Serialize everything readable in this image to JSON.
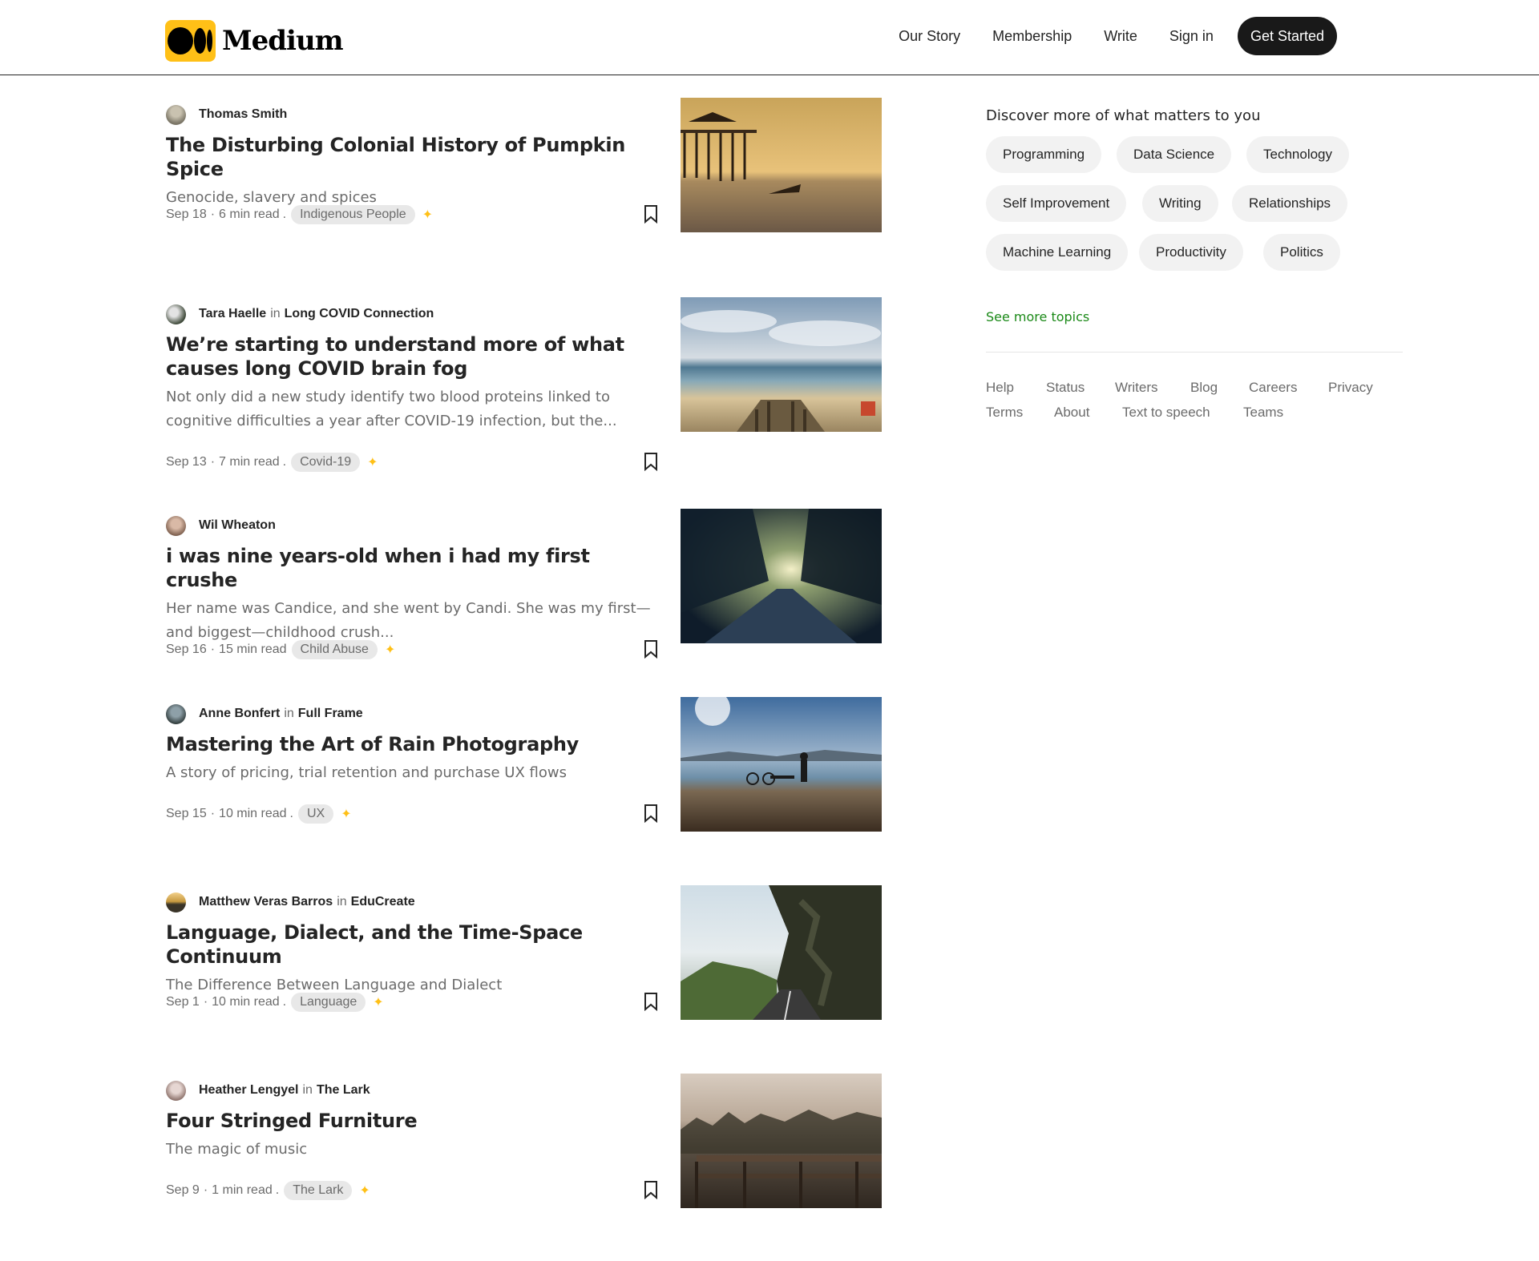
{
  "header": {
    "logo_text": "Medium",
    "nav": {
      "our_story": "Our Story",
      "membership": "Membership",
      "write": "Write",
      "sign_in": "Sign in",
      "get_started": "Get Started"
    }
  },
  "feed": {
    "articles": [
      {
        "author": "Thomas Smith",
        "in": "",
        "publication": "",
        "title": "The Disturbing Colonial History of Pumpkin Spice",
        "subtitle": "Genocide, slavery and spices",
        "date": "Sep 18",
        "read_time": "6 min read",
        "tag": "Indigenous People",
        "image": "pier-at-sunset"
      },
      {
        "author": "Tara Haelle",
        "in": "in",
        "publication": "Long COVID Connection",
        "title": "We’re starting to understand more of what causes long COVID brain fog",
        "subtitle": "Not only did a new study identify two blood proteins linked to cognitive difficulties a year after COVID-19 infection, but the...",
        "date": "Sep 13",
        "read_time": "7 min read",
        "tag": "Covid-19",
        "image": "beach-boardwalk"
      },
      {
        "author": "Wil Wheaton",
        "in": "",
        "publication": "",
        "title": "i was nine years-old when i had my first crushe",
        "subtitle": "Her name was Candice, and she went by Candi. She was my first—and biggest—childhood crush...",
        "date": "Sep 16",
        "read_time": "15 min read",
        "tag": "Child Abuse",
        "image": "forest-road"
      },
      {
        "author": "Anne Bonfert",
        "in": "in",
        "publication": "Full Frame",
        "title": "Mastering the Art of Rain Photography",
        "subtitle": "A story of pricing, trial retention and purchase UX flows",
        "date": "Sep 15",
        "read_time": "10 min read",
        "tag": "UX",
        "image": "person-by-lake"
      },
      {
        "author": "Matthew Veras Barros",
        "in": "in",
        "publication": "EduCreate",
        "title": "Language, Dialect, and the Time-Space Continuum",
        "subtitle": "The Difference Between Language and Dialect",
        "date": "Sep 1",
        "read_time": "10 min read",
        "tag": "Language",
        "image": "mountain-road-tunnel"
      },
      {
        "author": "Heather Lengyel",
        "in": "in",
        "publication": "The Lark",
        "title": "Four Stringed Furniture",
        "subtitle": "The magic of music",
        "date": "Sep 9",
        "read_time": "1 min read",
        "tag": "The Lark",
        "image": "misty-forest-bridge"
      }
    ],
    "meta_separator": "·",
    "tag_separator": ".",
    "sparkle_icon": "✦"
  },
  "sidebar": {
    "heading": "Discover more of what matters to you",
    "topics": [
      "Programming",
      "Data Science",
      "Technology",
      "Self Improvement",
      "Writing",
      "Relationships",
      "Machine Learning",
      "Productivity",
      "Politics"
    ],
    "see_more": "See more topics",
    "footer": [
      "Help",
      "Status",
      "Writers",
      "Blog",
      "Careers",
      "Privacy",
      "Terms",
      "About",
      "Text to speech",
      "Teams"
    ]
  },
  "colors": {
    "brand_yellow": "#ffc017",
    "cta_black": "#191919",
    "link_green": "#1a8917",
    "muted_text": "#6b6b6b",
    "tag_bg": "#e8e8e8",
    "topic_bg": "#f2f2f2"
  }
}
